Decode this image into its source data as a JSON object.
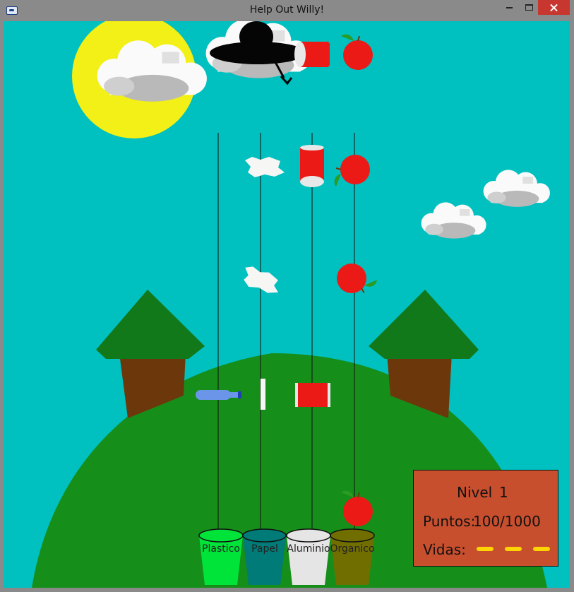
{
  "window": {
    "title": "Help Out Willy!"
  },
  "bins": [
    {
      "label": "Plastico",
      "color": "#00e43a"
    },
    {
      "label": "Papel",
      "color": "#007b78"
    },
    {
      "label": "Aluminio",
      "color": "#e5e5e5"
    },
    {
      "label": "Organico",
      "color": "#716e00"
    }
  ],
  "hud": {
    "level_label": "Nivel",
    "level_value": "1",
    "points_label": "Puntos:",
    "points_value": "100/1000",
    "lives_label": "Vidas:",
    "lives_count": 3
  },
  "icons": [
    "app-icon",
    "minimize-icon",
    "maximize-icon",
    "close-icon",
    "crow-icon",
    "sun-icon",
    "cloud-icon",
    "tree-icon",
    "bottle-icon",
    "paper-icon",
    "can-icon",
    "apple-icon"
  ],
  "colors": {
    "sky": "#00c0c0",
    "hill": "#168e1a",
    "sun": "#f2f016",
    "panel": "#c84f2e",
    "life": "#ffd400"
  }
}
